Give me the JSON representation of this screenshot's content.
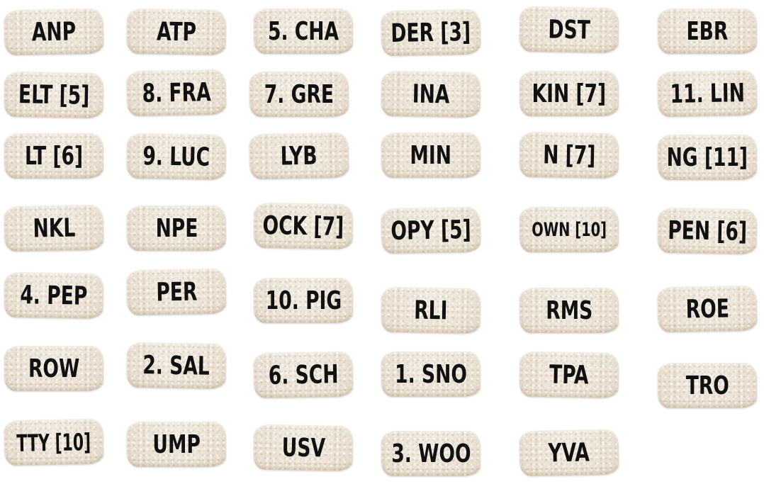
{
  "tiles": [
    {
      "label": "ANP"
    },
    {
      "label": "ATP"
    },
    {
      "label": "5. CHA"
    },
    {
      "label": "DER [3]"
    },
    {
      "label": "DST"
    },
    {
      "label": "EBR"
    },
    {
      "label": "ELT [5]"
    },
    {
      "label": "8. FRA"
    },
    {
      "label": "7. GRE"
    },
    {
      "label": "INA"
    },
    {
      "label": "KIN [7]"
    },
    {
      "label": "11. LIN"
    },
    {
      "label": "LT [6]"
    },
    {
      "label": "9. LUC"
    },
    {
      "label": "LYB"
    },
    {
      "label": "MIN"
    },
    {
      "label": "N [7]"
    },
    {
      "label": "NG [11]"
    },
    {
      "label": "NKL"
    },
    {
      "label": "NPE"
    },
    {
      "label": "OCK [7]"
    },
    {
      "label": "OPY [5]"
    },
    {
      "label": "OWN [10]"
    },
    {
      "label": "PEN [6]"
    },
    {
      "label": "4. PEP"
    },
    {
      "label": "PER"
    },
    {
      "label": "10. PIG"
    },
    {
      "label": "RLI"
    },
    {
      "label": "RMS"
    },
    {
      "label": "ROE"
    },
    {
      "label": "ROW"
    },
    {
      "label": "2. SAL"
    },
    {
      "label": "6. SCH"
    },
    {
      "label": "1. SNO"
    },
    {
      "label": "TPA"
    },
    {
      "label": "TRO"
    },
    {
      "label": "TTY [10]"
    },
    {
      "label": "UMP"
    },
    {
      "label": "USV"
    },
    {
      "label": "3. WOO"
    },
    {
      "label": "YVA"
    }
  ]
}
